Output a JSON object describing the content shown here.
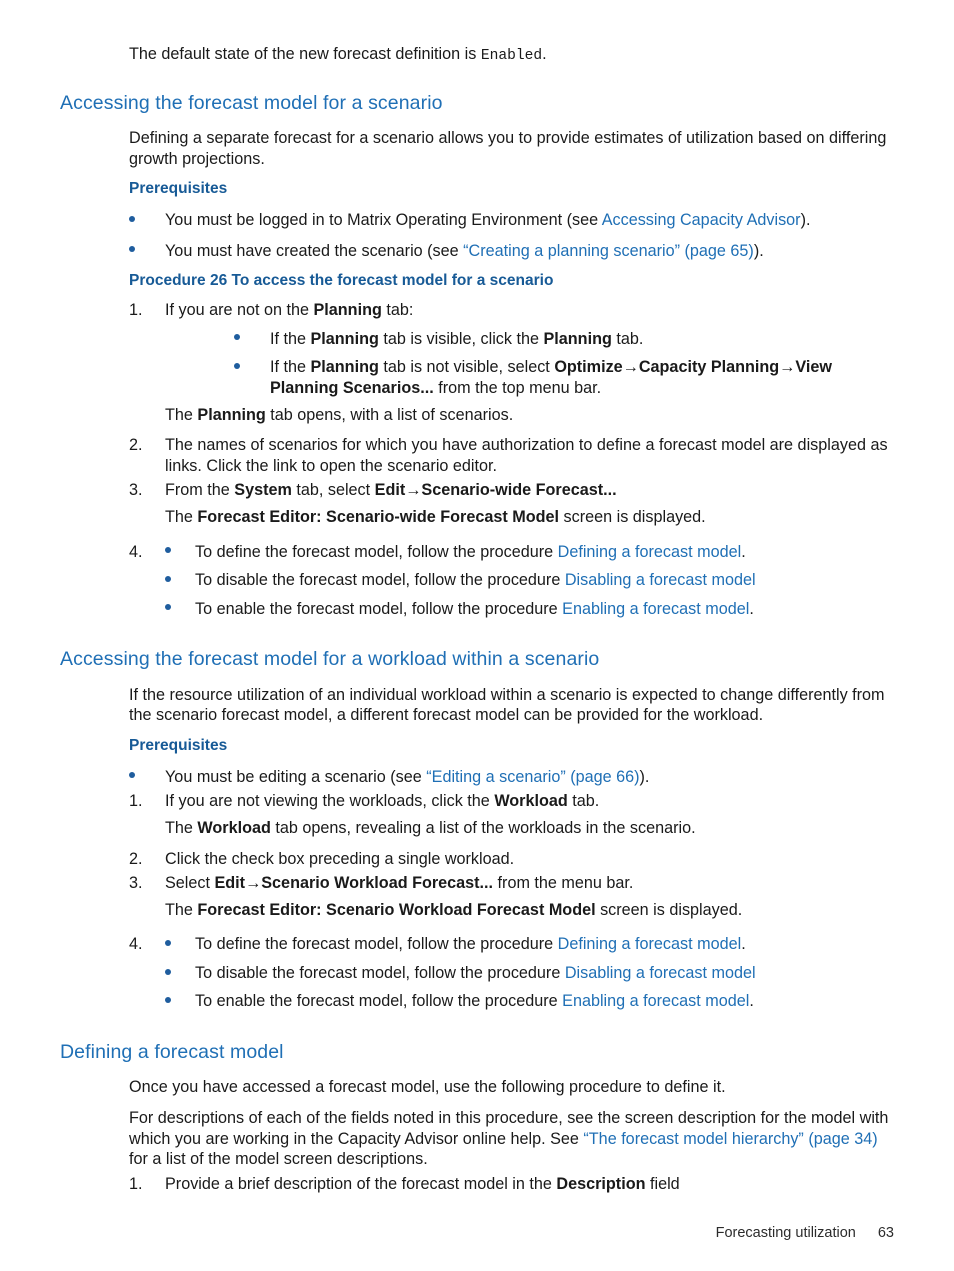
{
  "document": {
    "intro": {
      "lead": "The default state of the new forecast definition is ",
      "code": "Enabled",
      "tail": "."
    },
    "section_scenario": {
      "heading": "Accessing the forecast model for a scenario",
      "intro_paragraph": "Defining a separate forecast for a scenario allows you to provide estimates of utilization based on differing growth projections.",
      "prerequisites_heading": "Prerequisites",
      "prerequisites": [
        {
          "pre": "You must be logged in to Matrix Operating Environment (see ",
          "link": "Accessing Capacity Advisor",
          "post": ")."
        },
        {
          "pre": "You must have created the scenario (see ",
          "link": "“Creating a planning scenario” (page 65)",
          "post": ")."
        }
      ],
      "procedure_heading": "Procedure 26 To access the forecast model for a scenario",
      "steps": [
        {
          "number": "1.",
          "pre": "If you are not on the ",
          "bold": "Planning",
          "post": " tab:",
          "subbullets": [
            {
              "segments": [
                {
                  "t": "If the ",
                  "s": "plain"
                },
                {
                  "t": "Planning",
                  "s": "bold"
                },
                {
                  "t": " tab is visible, click the ",
                  "s": "plain"
                },
                {
                  "t": "Planning",
                  "s": "bold"
                },
                {
                  "t": " tab.",
                  "s": "plain"
                }
              ]
            },
            {
              "segments": [
                {
                  "t": "If the ",
                  "s": "plain"
                },
                {
                  "t": "Planning",
                  "s": "bold"
                },
                {
                  "t": " tab is not visible, select ",
                  "s": "plain"
                },
                {
                  "t": "Optimize→Capacity Planning→View Planning Scenarios...",
                  "s": "bold"
                },
                {
                  "t": " from the top menu bar.",
                  "s": "plain"
                }
              ]
            }
          ],
          "trailer": [
            {
              "t": "The ",
              "s": "plain"
            },
            {
              "t": "Planning",
              "s": "bold"
            },
            {
              "t": " tab opens, with a list of scenarios.",
              "s": "plain"
            }
          ]
        },
        {
          "number": "2.",
          "segments": [
            {
              "t": "The names of scenarios for which you have authorization to define a forecast model are displayed as links. Click the link to open the scenario editor.",
              "s": "plain"
            }
          ]
        },
        {
          "number": "3.",
          "segments": [
            {
              "t": "From the ",
              "s": "plain"
            },
            {
              "t": "System",
              "s": "bold"
            },
            {
              "t": " tab, select ",
              "s": "plain"
            },
            {
              "t": "Edit→Scenario-wide Forecast...",
              "s": "bold"
            }
          ],
          "trailer": [
            {
              "t": "The ",
              "s": "plain"
            },
            {
              "t": "Forecast Editor: Scenario-wide Forecast Model",
              "s": "bold"
            },
            {
              "t": " screen is displayed.",
              "s": "plain"
            }
          ]
        }
      ],
      "step4_number": "4.",
      "step4_bullets": [
        {
          "pre": "To define the forecast model, follow the procedure ",
          "link": "Defining a forecast model",
          "post": "."
        },
        {
          "pre": "To disable the forecast model, follow the procedure ",
          "link": "Disabling a forecast model",
          "post": ""
        },
        {
          "pre": "To enable the forecast model, follow the procedure ",
          "link": "Enabling a forecast model",
          "post": "."
        }
      ]
    },
    "section_workload": {
      "heading": "Accessing the forecast model for a workload within a scenario",
      "intro_paragraph": "If the resource utilization of an individual workload within a scenario is expected to change differently from the scenario forecast model, a different forecast model can be provided for the workload.",
      "prerequisites_heading": "Prerequisites",
      "prerequisite": {
        "pre": "You must be editing a scenario (see ",
        "link": "“Editing a scenario” (page 66)",
        "post": ")."
      },
      "steps": [
        {
          "number": "1.",
          "segments": [
            {
              "t": "If you are not viewing the workloads, click the ",
              "s": "plain"
            },
            {
              "t": "Workload",
              "s": "bold"
            },
            {
              "t": " tab.",
              "s": "plain"
            }
          ],
          "trailer": [
            {
              "t": "The ",
              "s": "plain"
            },
            {
              "t": "Workload",
              "s": "bold"
            },
            {
              "t": " tab opens, revealing a list of the workloads in the scenario.",
              "s": "plain"
            }
          ]
        },
        {
          "number": "2.",
          "segments": [
            {
              "t": "Click the check box preceding a single workload.",
              "s": "plain"
            }
          ]
        },
        {
          "number": "3.",
          "segments": [
            {
              "t": "Select ",
              "s": "plain"
            },
            {
              "t": "Edit→Scenario Workload Forecast...",
              "s": "bold"
            },
            {
              "t": " from the menu bar.",
              "s": "plain"
            }
          ],
          "trailer": [
            {
              "t": "The ",
              "s": "plain"
            },
            {
              "t": "Forecast Editor: Scenario Workload Forecast Model",
              "s": "bold"
            },
            {
              "t": " screen is displayed.",
              "s": "plain"
            }
          ]
        }
      ],
      "step4_number": "4.",
      "step4_bullets": [
        {
          "pre": "To define the forecast model, follow the procedure ",
          "link": "Defining a forecast model",
          "post": "."
        },
        {
          "pre": "To disable the forecast model, follow the procedure ",
          "link": "Disabling a forecast model",
          "post": ""
        },
        {
          "pre": "To enable the forecast model, follow the procedure ",
          "link": "Enabling a forecast model",
          "post": "."
        }
      ]
    },
    "section_defining": {
      "heading": "Defining a forecast model",
      "paragraph1": "Once you have accessed a forecast model, use the following procedure to define it.",
      "paragraph2": {
        "pre": "For descriptions of each of the fields noted in this procedure, see the screen description for the model with which you are working in the Capacity Advisor online help. See ",
        "link": "“The forecast model hierarchy” (page 34)",
        "post": " for a list of the model screen descriptions."
      },
      "step": {
        "number": "1.",
        "segments": [
          {
            "t": "Provide a brief description of the forecast model in the ",
            "s": "plain"
          },
          {
            "t": "Description",
            "s": "bold"
          },
          {
            "t": " field",
            "s": "plain"
          }
        ]
      }
    },
    "footer": {
      "chapter": "Forecasting utilization",
      "page_number": "63"
    },
    "colors": {
      "heading_blue": "#1f6fb5",
      "subheading_blue": "#175a96",
      "link_blue": "#1f6fb5",
      "bullet_blue": "#1f5d9e",
      "body_black": "#1a1a1a"
    }
  }
}
